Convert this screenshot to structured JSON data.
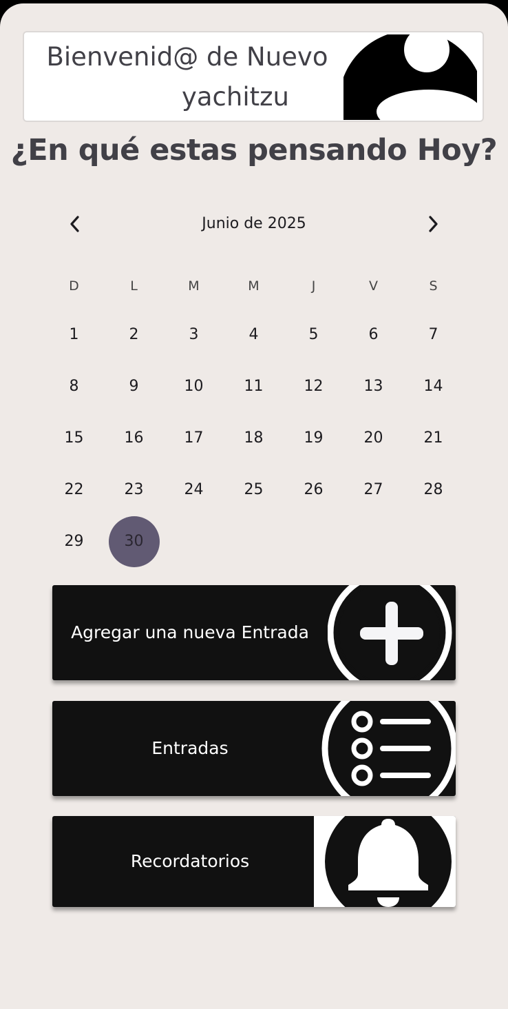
{
  "header": {
    "greeting": "Bienvenid@ de Nuevo",
    "username": "yachitzu",
    "avatar_icon": "user-avatar-icon"
  },
  "prompt": "¿En qué estas pensando Hoy?",
  "calendar": {
    "month_label": "Junio de 2025",
    "prev_icon": "chevron-left-icon",
    "next_icon": "chevron-right-icon",
    "weekdays": [
      "D",
      "L",
      "M",
      "M",
      "J",
      "V",
      "S"
    ],
    "days": [
      "1",
      "2",
      "3",
      "4",
      "5",
      "6",
      "7",
      "8",
      "9",
      "10",
      "11",
      "12",
      "13",
      "14",
      "15",
      "16",
      "17",
      "18",
      "19",
      "20",
      "21",
      "22",
      "23",
      "24",
      "25",
      "26",
      "27",
      "28",
      "29",
      "30"
    ],
    "selected_day": "30",
    "selected_color": "#615a73"
  },
  "actions": {
    "add_entry_label": "Agregar una nueva Entrada",
    "add_entry_icon": "plus-circle-icon",
    "entries_label": "Entradas",
    "entries_icon": "list-icon",
    "reminders_label": "Recordatorios",
    "reminders_icon": "bell-icon"
  },
  "colors": {
    "background": "#efeae7",
    "text": "#414047",
    "button": "#111111"
  }
}
